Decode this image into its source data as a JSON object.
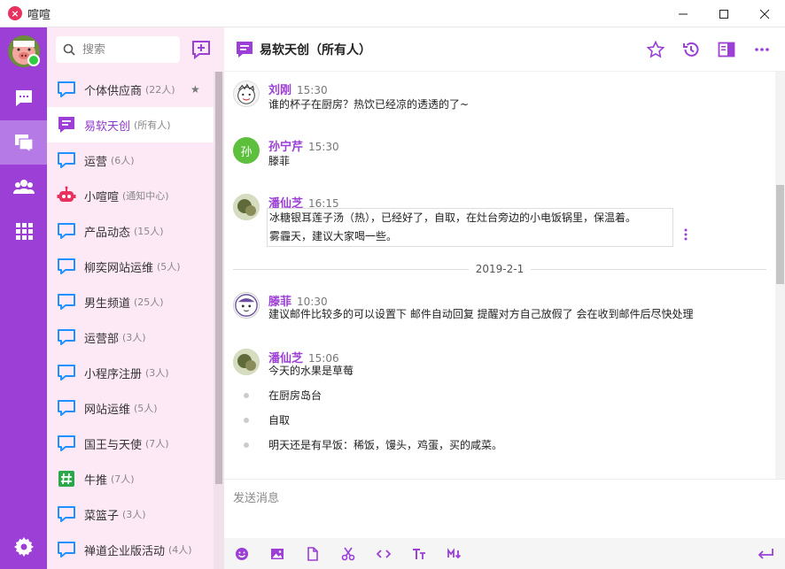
{
  "app": {
    "title": "喧喧",
    "logo": "×"
  },
  "colors": {
    "accent": "#9b3fd6",
    "sidebar_bg": "#fde8f6",
    "online": "#2ecc40"
  },
  "search": {
    "placeholder": "搜索"
  },
  "chats": [
    {
      "icon": "chat-bubble-icon",
      "name": "个体供应商",
      "count": "(22人)",
      "starred": true,
      "active": false
    },
    {
      "icon": "list-doc-icon",
      "name": "易软天创",
      "count": "(所有人)",
      "starred": false,
      "active": true
    },
    {
      "icon": "chat-bubble-icon",
      "name": "运营",
      "count": "(6人)",
      "starred": false,
      "active": false
    },
    {
      "icon": "robot-icon",
      "name": "小喧喧",
      "count": "(通知中心)",
      "starred": false,
      "active": false
    },
    {
      "icon": "chat-bubble-icon",
      "name": "产品动态",
      "count": "(15人)",
      "starred": false,
      "active": false
    },
    {
      "icon": "chat-bubble-icon",
      "name": "柳奕网站运维",
      "count": "(5人)",
      "starred": false,
      "active": false
    },
    {
      "icon": "chat-bubble-icon",
      "name": "男生频道",
      "count": "(25人)",
      "starred": false,
      "active": false
    },
    {
      "icon": "chat-bubble-icon",
      "name": "运营部",
      "count": "(3人)",
      "starred": false,
      "active": false
    },
    {
      "icon": "chat-bubble-icon",
      "name": "小程序注册",
      "count": "(3人)",
      "starred": false,
      "active": false
    },
    {
      "icon": "chat-bubble-icon",
      "name": "网站运维",
      "count": "(5人)",
      "starred": false,
      "active": false
    },
    {
      "icon": "chat-bubble-icon",
      "name": "国王与天使",
      "count": "(7人)",
      "starred": false,
      "active": false
    },
    {
      "icon": "hashtag-icon",
      "name": "牛推",
      "count": "(7人)",
      "starred": false,
      "active": false
    },
    {
      "icon": "chat-bubble-icon",
      "name": "菜篮子",
      "count": "(3人)",
      "starred": false,
      "active": false
    },
    {
      "icon": "chat-bubble-icon",
      "name": "禅道企业版活动",
      "count": "(4人)",
      "starred": false,
      "active": false
    }
  ],
  "header": {
    "title": "易软天创（所有人）"
  },
  "messages": {
    "m1": {
      "sender": "刘刚",
      "time": "15:30",
      "text": "谁的杯子在厨房？热饮已经凉的透透的了~"
    },
    "m2": {
      "sender": "孙宁芹",
      "time": "15:30",
      "avatar_text": "孙",
      "text": "滕菲"
    },
    "m3": {
      "sender": "潘仙芝",
      "time": "16:15",
      "line1": "冰糖银耳莲子汤（热），已经好了，自取，在灶台旁边的小电饭锅里，保温着。",
      "line2": "雾霾天，建议大家喝一些。"
    },
    "date": "2019-2-1",
    "m4": {
      "sender": "滕菲",
      "time": "10:30",
      "text": "建议邮件比较多的可以设置下 邮件自动回复 提醒对方自己放假了 会在收到邮件后尽快处理"
    },
    "m5": {
      "sender": "潘仙芝",
      "time": "15:06",
      "text": "今天的水果是草莓",
      "items": [
        "在厨房岛台",
        "自取",
        "明天还是有早饭：稀饭，馒头，鸡蛋，买的咸菜。"
      ]
    }
  },
  "composer": {
    "placeholder": "发送消息"
  }
}
